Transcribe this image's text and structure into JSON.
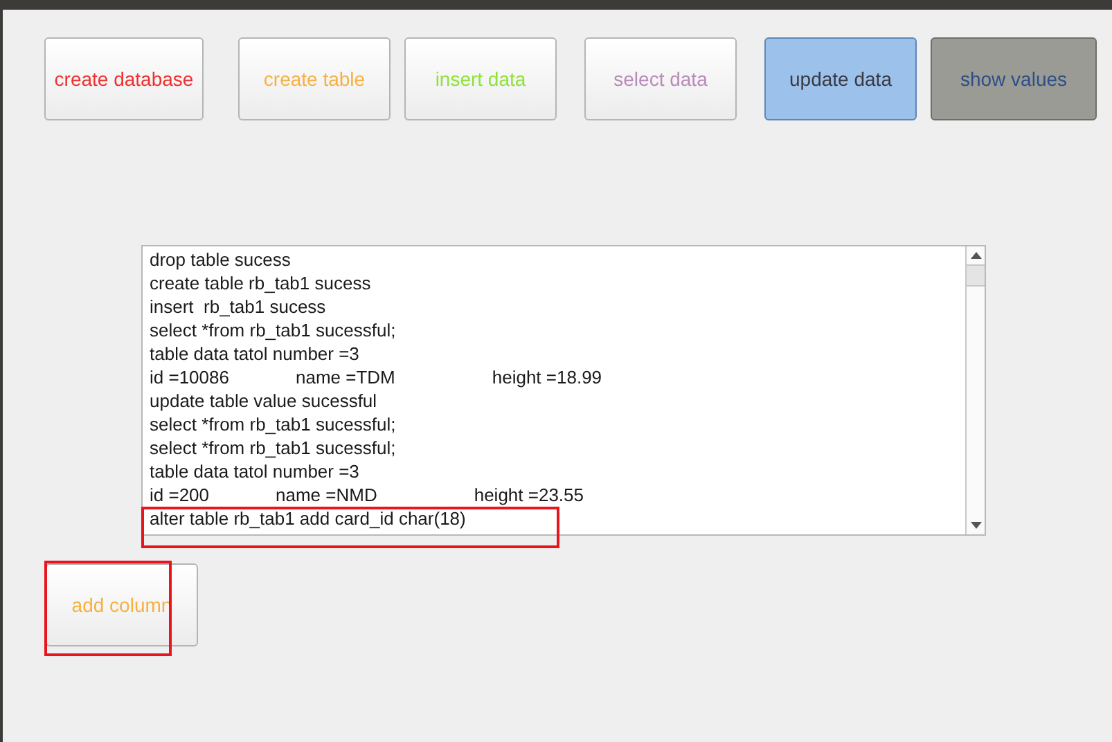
{
  "buttons": [
    {
      "label": "create database",
      "color": "#f03030",
      "kind": "plain"
    },
    {
      "label": "create table",
      "color": "#f7b142",
      "kind": "plain"
    },
    {
      "label": "insert data",
      "color": "#8fe23a",
      "kind": "plain"
    },
    {
      "label": "select data",
      "color": "#b88bb8",
      "kind": "plain"
    },
    {
      "label": "update data",
      "color": "#3a3a44",
      "kind": "blue"
    },
    {
      "label": "show values",
      "color": "#2c4f86",
      "kind": "grey"
    }
  ],
  "log": {
    "lines": [
      {
        "kind": "text",
        "text": "drop table sucess"
      },
      {
        "kind": "text",
        "text": "create table rb_tab1 sucess"
      },
      {
        "kind": "text",
        "text": "insert  rb_tab1 sucess"
      },
      {
        "kind": "text",
        "text": "select *from rb_tab1 sucessful;"
      },
      {
        "kind": "text",
        "text": "table data tatol number =3"
      },
      {
        "kind": "record",
        "fields": [
          "id =10086",
          "name =TDM",
          "height =18.99"
        ]
      },
      {
        "kind": "text",
        "text": "update table value sucessful"
      },
      {
        "kind": "text",
        "text": "select *from rb_tab1 sucessful;"
      },
      {
        "kind": "text",
        "text": "select *from rb_tab1 sucessful;"
      },
      {
        "kind": "text",
        "text": "table data tatol number =3"
      },
      {
        "kind": "record",
        "fields": [
          "id =200",
          "name =NMD",
          "height =23.55"
        ]
      },
      {
        "kind": "text",
        "text": "alter table rb_tab1 add card_id char(18)"
      }
    ]
  },
  "add_button": {
    "label": "add column",
    "color": "#f7b142"
  }
}
